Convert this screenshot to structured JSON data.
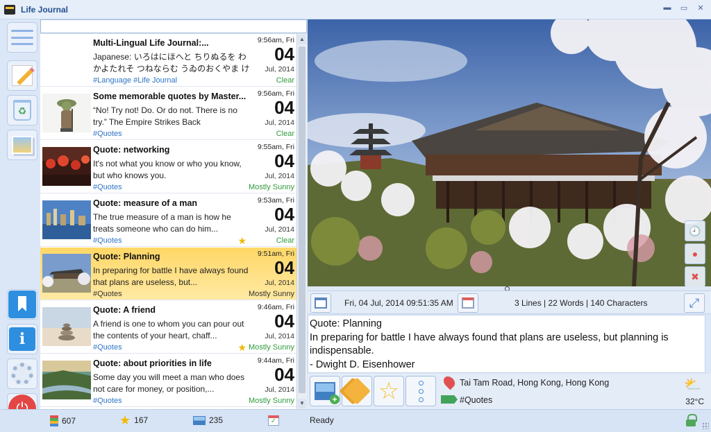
{
  "window": {
    "title": "Life Journal"
  },
  "entries": [
    {
      "title": "Multi-Lingual Life Journal:...",
      "body": "Japanese: いろはにほへと ちりぬるを わかよたれそ つねならむ うゐのおくやま けふこえて あ...",
      "tags": "#Language #Life Journal",
      "time": "9:56am, Fri",
      "day": "04",
      "monthyear": "Jul, 2014",
      "weather": "Clear",
      "starred": false
    },
    {
      "title": "Some memorable quotes by Master...",
      "body": "“No! Try not! Do. Or do not. There is no try.” The Empire Strikes Back",
      "tags": "#Quotes",
      "time": "9:56am, Fri",
      "day": "04",
      "monthyear": "Jul, 2014",
      "weather": "Clear",
      "starred": false
    },
    {
      "title": "Quote: networking",
      "body": "It's not what you know or who you know, but who knows you.",
      "tags": "#Quotes",
      "time": "9:55am, Fri",
      "day": "04",
      "monthyear": "Jul, 2014",
      "weather": "Mostly Sunny",
      "starred": false
    },
    {
      "title": "Quote: measure of a man",
      "body": "The true measure of a man is how he treats someone who can do him...",
      "tags": "#Quotes",
      "time": "9:53am, Fri",
      "day": "04",
      "monthyear": "Jul, 2014",
      "weather": "Clear",
      "starred": true
    },
    {
      "title": "Quote: Planning",
      "body": "In preparing for battle I have always found that plans are useless, but...",
      "tags": "#Quotes",
      "time": "9:51am, Fri",
      "day": "04",
      "monthyear": "Jul, 2014",
      "weather": "Mostly Sunny",
      "starred": false
    },
    {
      "title": "Quote: A friend",
      "body": "A friend is one to whom you can pour out the contents of your heart, chaff...",
      "tags": "#Quotes",
      "time": "9:46am, Fri",
      "day": "04",
      "monthyear": "Jul, 2014",
      "weather": "Mostly Sunny",
      "starred": true
    },
    {
      "title": "Quote: about priorities in life",
      "body": "Some day you will meet a man who does not care for money, or position,...",
      "tags": "#Quotes",
      "time": "9:44am, Fri",
      "day": "04",
      "monthyear": "Jul, 2014",
      "weather": "Mostly Sunny",
      "starred": false
    }
  ],
  "selected_index": 4,
  "detail": {
    "datetime": "Fri, 04 Jul, 2014 09:51:35 AM",
    "counts": "3 Lines | 22 Words | 140 Characters",
    "lines": [
      "Quote: Planning",
      "In preparing for battle I have always found that plans are useless, but planning is",
      "indispensable.",
      "- Dwight D. Eisenhower"
    ],
    "location": "Tai Tam Road, Hong Kong, Hong Kong",
    "tags": "#Quotes",
    "temperature": "32°C"
  },
  "status": {
    "entries_count": "607",
    "starred_count": "167",
    "photos_count": "235",
    "state": "Ready"
  },
  "icons": {
    "menu": "menu-icon",
    "new": "pencil-icon",
    "trash": "recycle-bin-icon",
    "photos": "photos-icon",
    "bookmark": "bookmark-icon",
    "info": "info-icon",
    "settings": "gear-icon",
    "exit": "power-icon"
  }
}
